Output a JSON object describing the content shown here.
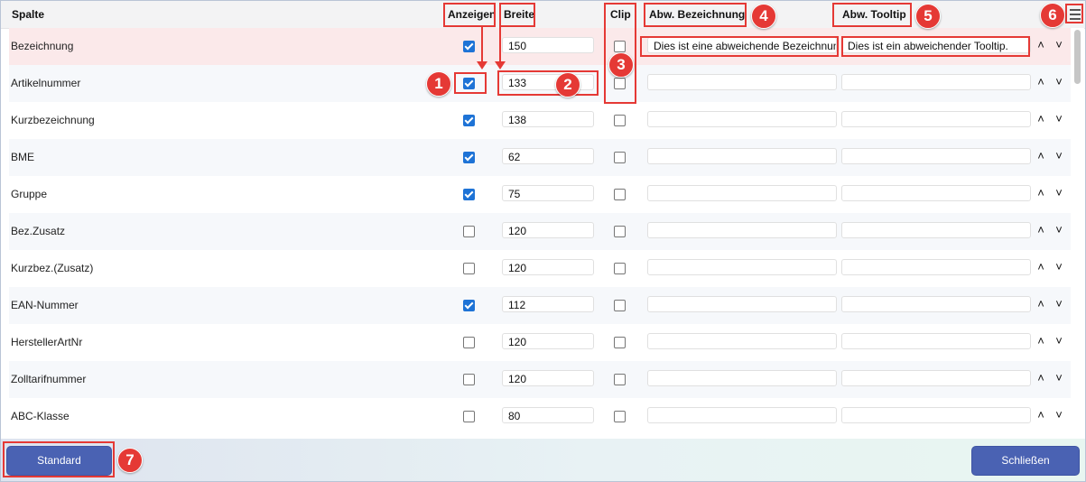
{
  "header": {
    "spalte": "Spalte",
    "anzeigen": "Anzeigen",
    "breite": "Breite",
    "clip": "Clip",
    "abw_bezeichnung": "Abw. Bezeichnung",
    "abw_tooltip": "Abw. Tooltip"
  },
  "rows": [
    {
      "name": "Bezeichnung",
      "anzeigen": true,
      "breite": "150",
      "clip": false,
      "abw_bezeichnung": "Dies ist eine abweichende Bezeichnung",
      "abw_tooltip": "Dies ist ein abweichender Tooltip."
    },
    {
      "name": "Artikelnummer",
      "anzeigen": true,
      "breite": "133",
      "clip": false,
      "abw_bezeichnung": "",
      "abw_tooltip": ""
    },
    {
      "name": "Kurzbezeichnung",
      "anzeigen": true,
      "breite": "138",
      "clip": false,
      "abw_bezeichnung": "",
      "abw_tooltip": ""
    },
    {
      "name": "BME",
      "anzeigen": true,
      "breite": "62",
      "clip": false,
      "abw_bezeichnung": "",
      "abw_tooltip": ""
    },
    {
      "name": "Gruppe",
      "anzeigen": true,
      "breite": "75",
      "clip": false,
      "abw_bezeichnung": "",
      "abw_tooltip": ""
    },
    {
      "name": "Bez.Zusatz",
      "anzeigen": false,
      "breite": "120",
      "clip": false,
      "abw_bezeichnung": "",
      "abw_tooltip": ""
    },
    {
      "name": "Kurzbez.(Zusatz)",
      "anzeigen": false,
      "breite": "120",
      "clip": false,
      "abw_bezeichnung": "",
      "abw_tooltip": ""
    },
    {
      "name": "EAN-Nummer",
      "anzeigen": true,
      "breite": "112",
      "clip": false,
      "abw_bezeichnung": "",
      "abw_tooltip": ""
    },
    {
      "name": "HerstellerArtNr",
      "anzeigen": false,
      "breite": "120",
      "clip": false,
      "abw_bezeichnung": "",
      "abw_tooltip": ""
    },
    {
      "name": "Zolltarifnummer",
      "anzeigen": false,
      "breite": "120",
      "clip": false,
      "abw_bezeichnung": "",
      "abw_tooltip": ""
    },
    {
      "name": "ABC-Klasse",
      "anzeigen": false,
      "breite": "80",
      "clip": false,
      "abw_bezeichnung": "",
      "abw_tooltip": ""
    }
  ],
  "arrows": {
    "up": "˄",
    "down": "˅"
  },
  "badges": [
    "1",
    "2",
    "3",
    "4",
    "5",
    "6",
    "7"
  ],
  "footer": {
    "standard_label": "Standard",
    "close_label": "Schließen"
  },
  "colors": {
    "accent": "#4a62b3",
    "checkbox": "#1e73d6",
    "highlight": "#e53935",
    "selected_row": "#fbe9ea"
  },
  "icons": {
    "menu": "menu-icon",
    "move_up": "chevron-up-icon",
    "move_down": "chevron-down-icon"
  }
}
